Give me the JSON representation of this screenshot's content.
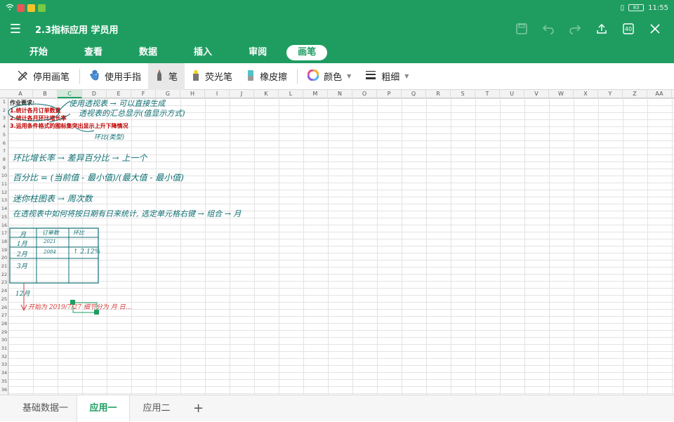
{
  "status": {
    "battery": "83",
    "time": "11:55"
  },
  "title": "2.3指标应用 学员用",
  "tabs": [
    "开始",
    "查看",
    "数据",
    "插入",
    "审阅",
    "画笔"
  ],
  "active_tab": "画笔",
  "badge_count": "40",
  "toolbar": {
    "stop_pen": "停用画笔",
    "use_finger": "使用手指",
    "pen": "笔",
    "highlighter": "荧光笔",
    "eraser": "橡皮擦",
    "color": "颜色",
    "thickness": "粗细"
  },
  "columns": [
    "A",
    "B",
    "C",
    "D",
    "E",
    "F",
    "G",
    "H",
    "I",
    "J",
    "K",
    "L",
    "M",
    "N",
    "O",
    "P",
    "Q",
    "R",
    "S",
    "T",
    "U",
    "V",
    "W",
    "X",
    "Y",
    "Z",
    "AA"
  ],
  "selected_column": "C",
  "rows": [
    "1",
    "2",
    "3",
    "4",
    "5",
    "6",
    "7",
    "8",
    "9",
    "10",
    "11",
    "12",
    "13",
    "14",
    "15",
    "16",
    "17",
    "18",
    "19",
    "20",
    "21",
    "22",
    "23",
    "24",
    "25",
    "26",
    "27",
    "28",
    "29",
    "30",
    "31",
    "32",
    "33",
    "34",
    "35",
    "36"
  ],
  "cells": {
    "r1": "作业要求:",
    "r2": "1.统计各月订单数量",
    "r3": "2.统计各月环比增长率",
    "r4": "3.运用条件格式的图标集突出显示上升下降情况"
  },
  "ink": {
    "n1": "使用透视表 → 可以直接生成",
    "n2": "透视表的汇总显示(值显示方式)",
    "n3": "环比(类型)",
    "n4": "环比增长率 → 差异百分比 → 上一个",
    "n5": "百分比 = (当前值 - 最小值)/(最大值 - 最小值)",
    "n6": "迷你柱图表 → 周次数",
    "n7": "在透视表中如何将按日期有日来统计, 选定单元格右键 → 组合 → 月",
    "t_h1": "订单数",
    "t_h2": "环比",
    "t_h0": "月",
    "t_r1a": "1月",
    "t_r1b": "2021",
    "t_r2a": "2月",
    "t_r2b": "2084",
    "t_r2c": "↑ 2.12%",
    "t_r3a": "3月",
    "t_r6a": "12月",
    "red": "开始为 2019/7/27 细节分为 月 日..."
  },
  "sheets": [
    "基础数据一",
    "应用一",
    "应用二"
  ],
  "active_sheet": "应用一",
  "colors": {
    "primary": "#1f9d61",
    "ink": "#0f6f73",
    "red_ink": "#d83a3a",
    "cell_red": "#c00000"
  }
}
